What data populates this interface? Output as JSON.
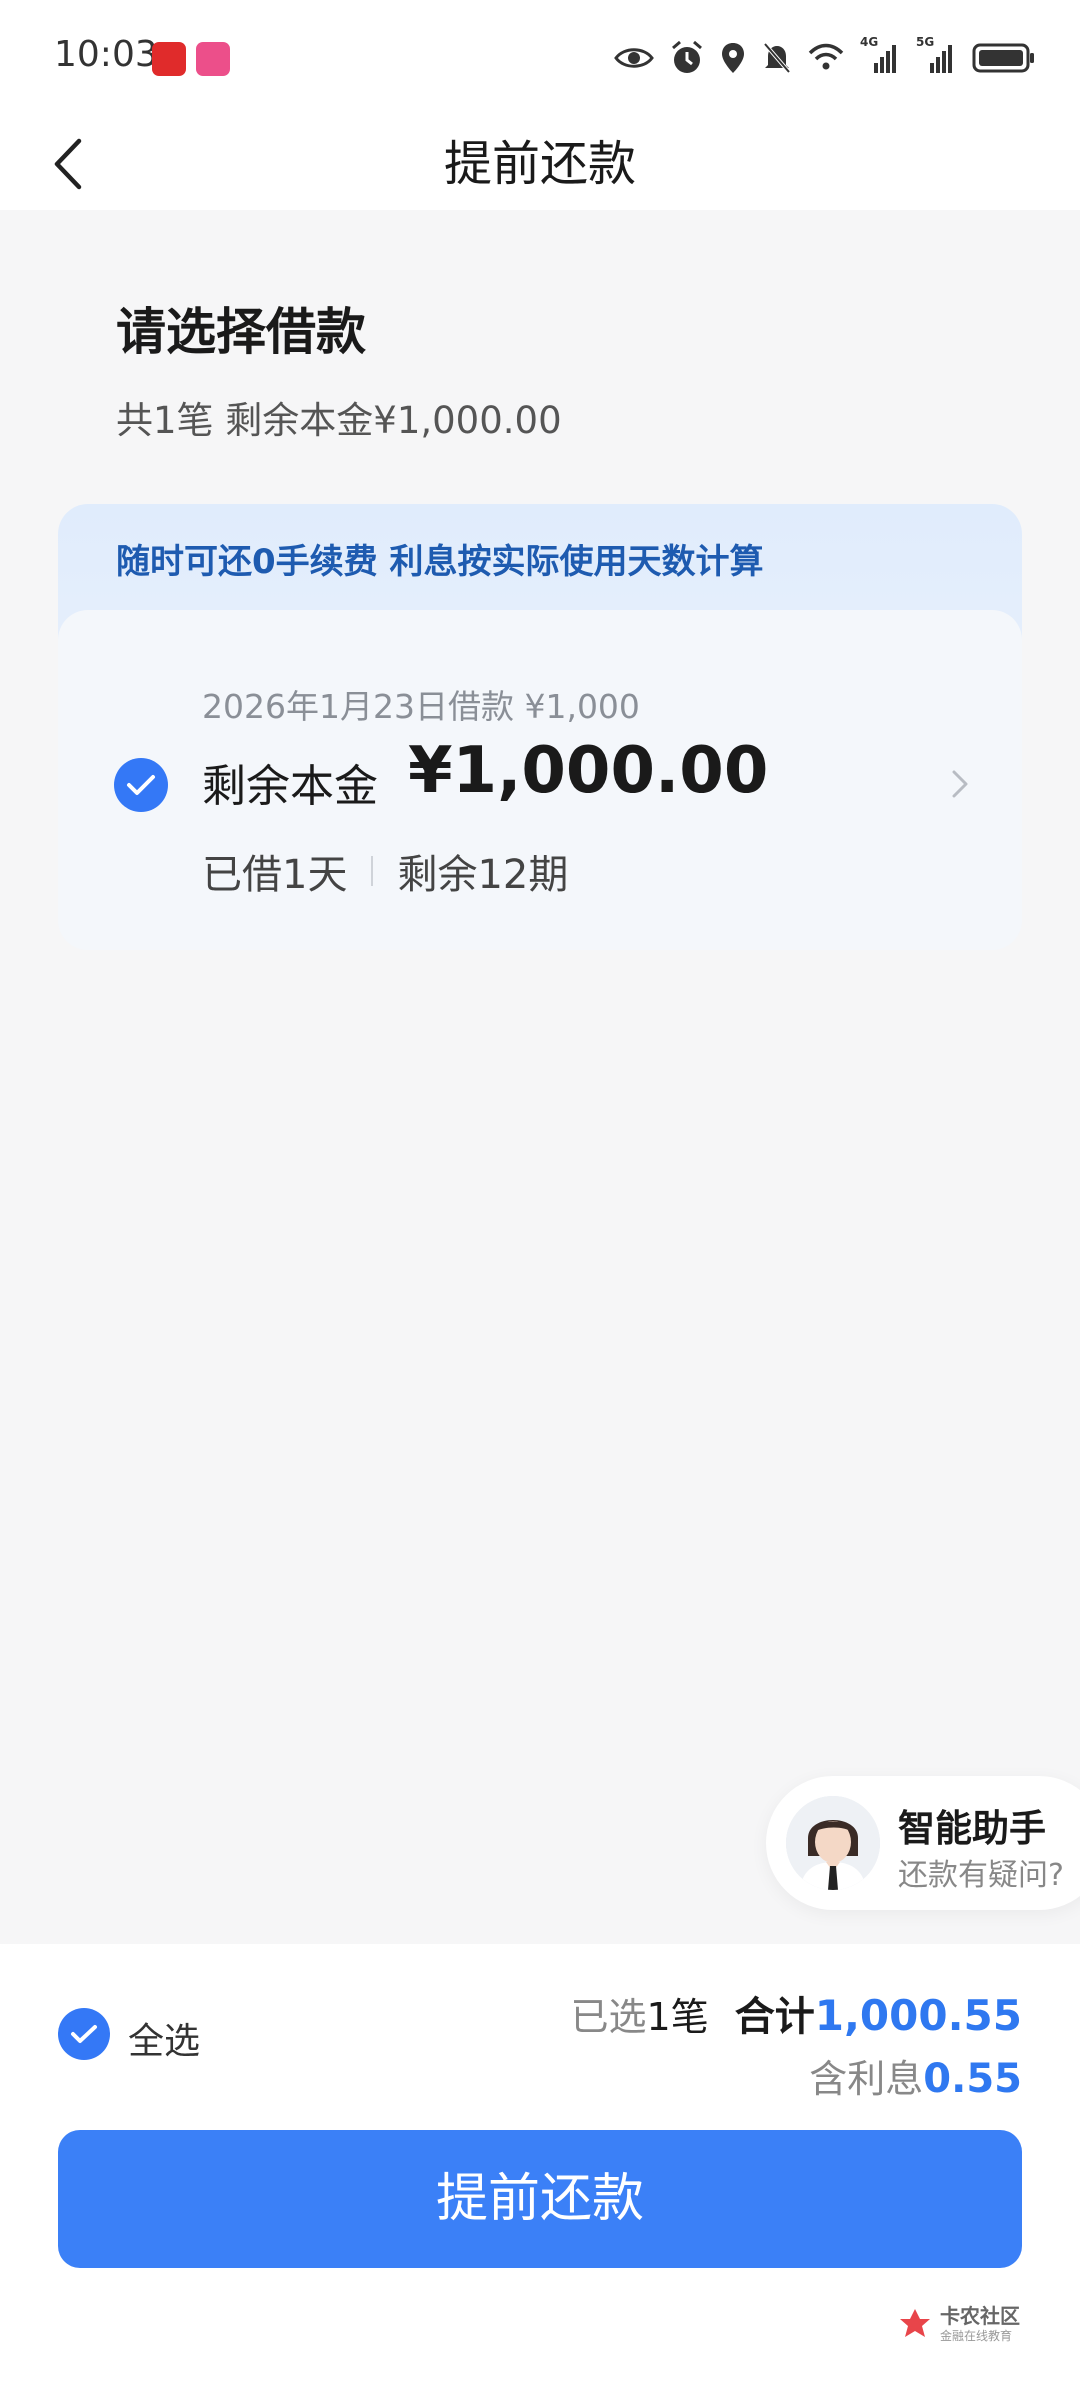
{
  "status_bar": {
    "time": "10:03",
    "network_1": "4G",
    "network_2": "5G",
    "icons": [
      "app-badge-red",
      "app-badge-pink",
      "eye-icon",
      "alarm-icon",
      "location-icon",
      "bell-mute-icon",
      "wifi-icon",
      "signal-icon",
      "signal-icon",
      "battery-icon"
    ]
  },
  "nav": {
    "title": "提前还款",
    "back_icon": "chevron-left-icon"
  },
  "section": {
    "title": "请选择借款",
    "summary": "共1笔 剩余本金¥1,000.00"
  },
  "loan_card": {
    "banner": "随时可还0手续费 利息按实际使用天数计算",
    "meta": "2026年1月23日借款 ¥1,000",
    "principal_label": "剩余本金",
    "principal_amount": "¥1,000.00",
    "borrowed_days": "已借1天",
    "remaining_periods": "剩余12期",
    "selected": true
  },
  "assistant": {
    "title": "智能助手",
    "subtitle": "还款有疑问?"
  },
  "footer": {
    "select_all_label": "全选",
    "selected_prefix": "已选",
    "selected_count": "1",
    "selected_unit": "笔",
    "total_label": "合计",
    "total_value": "1,000.55",
    "interest_label": "含利息",
    "interest_value": "0.55",
    "button_label": "提前还款"
  },
  "watermark": {
    "main": "卡农社区",
    "sub": "金融在线教育"
  },
  "colors": {
    "accent": "#3b80f7",
    "banner_text": "#1e5bb0",
    "background": "#f6f6f7"
  }
}
